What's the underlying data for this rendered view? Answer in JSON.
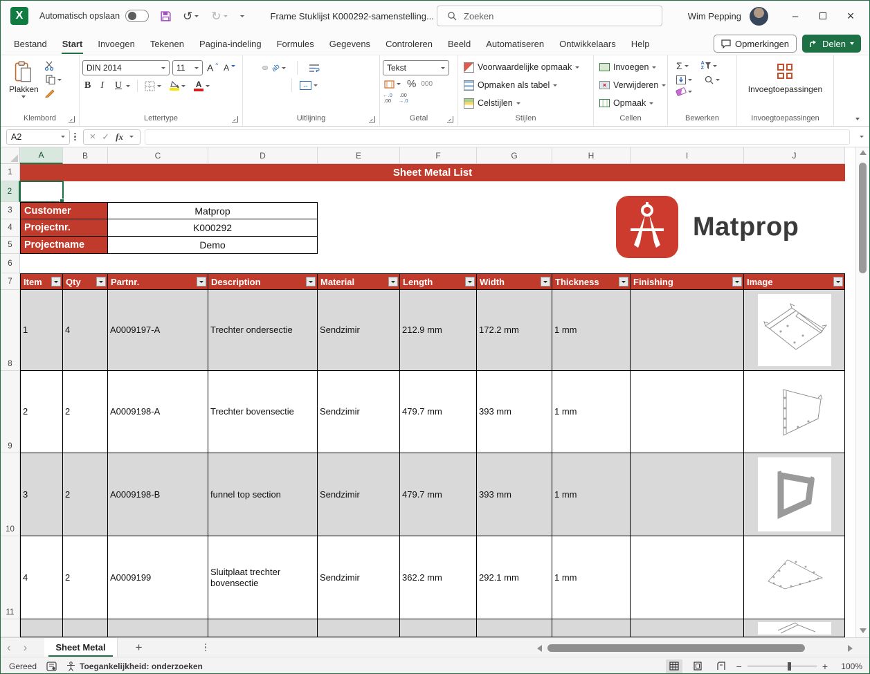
{
  "window": {
    "autosave_label": "Automatisch opslaan",
    "title": "Frame Stuklijst K000292-samenstelling...",
    "search_placeholder": "Zoeken",
    "user_name": "Wim Pepping"
  },
  "icons": {
    "excel": "X",
    "undo": "↺",
    "redo": "↻",
    "minimize": "–",
    "close": "×",
    "cancel": "×",
    "enter": "✓",
    "fx": "fx",
    "prev_sheet": "‹",
    "next_sheet": "›",
    "add_sheet": "+",
    "sum": "Σ",
    "percent": "%",
    "thousands": "000",
    "bold": "B",
    "italic": "I",
    "underline": "U",
    "font_increase": "A",
    "font_decrease": "A",
    "font_color": "A",
    "merge_arrows": "↔",
    "orientation": "ab",
    "sort_a": "A",
    "sort_z": "Z",
    "dec_left": "←.0",
    "dec_left2": ".00",
    "dec_right": ".00",
    "dec_right2": "→.0"
  },
  "ribbon": {
    "tabs": [
      "Bestand",
      "Start",
      "Invoegen",
      "Tekenen",
      "Pagina-indeling",
      "Formules",
      "Gegevens",
      "Controleren",
      "Beeld",
      "Automatiseren",
      "Ontwikkelaars",
      "Help"
    ],
    "comments_label": "Opmerkingen",
    "share_label": "Delen",
    "paste_label": "Plakken",
    "font_name": "DIN 2014",
    "font_size": "11",
    "number_format": "Tekst",
    "styles": {
      "conditional": "Voorwaardelijke opmaak",
      "format_table": "Opmaken als tabel",
      "cell_styles": "Celstijlen"
    },
    "cells": {
      "insert": "Invoegen",
      "delete": "Verwijderen",
      "format": "Opmaak"
    },
    "addins_button": "Invoegtoepassingen",
    "groups": {
      "clipboard": "Klembord",
      "font": "Lettertype",
      "alignment": "Uitlijning",
      "number": "Getal",
      "styles": "Stijlen",
      "cells": "Cellen",
      "editing": "Bewerken",
      "addins": "Invoegtoepassingen"
    }
  },
  "formula_bar": {
    "name_box": "A2",
    "formula": ""
  },
  "sheet": {
    "columns": [
      "A",
      "B",
      "C",
      "D",
      "E",
      "F",
      "G",
      "H",
      "I",
      "J"
    ],
    "row_headers": [
      "1",
      "2",
      "3",
      "4",
      "5",
      "6",
      "7",
      "8",
      "9",
      "10",
      "11"
    ],
    "banner_title": "Sheet Metal List",
    "info_labels": [
      "Customer",
      "Projectnr.",
      "Projectname"
    ],
    "info_values": [
      "Matprop",
      "K000292",
      "Demo"
    ],
    "logo_text": "Matprop",
    "table_headers": [
      "Item",
      "Qty",
      "Partnr.",
      "Description",
      "Material",
      "Length",
      "Width",
      "Thickness",
      "Finishing",
      "Image"
    ],
    "rows": [
      {
        "item": "1",
        "qty": "4",
        "partnr": "A0009197-A",
        "description": "Trechter ondersectie",
        "material": "Sendzimir",
        "length": "212.9 mm",
        "width": "172.2 mm",
        "thickness": "1 mm",
        "finishing": ""
      },
      {
        "item": "2",
        "qty": "2",
        "partnr": "A0009198-A",
        "description": "Trechter bovensectie",
        "material": "Sendzimir",
        "length": "479.7 mm",
        "width": "393 mm",
        "thickness": "1 mm",
        "finishing": ""
      },
      {
        "item": "3",
        "qty": "2",
        "partnr": "A0009198-B",
        "description": "funnel top section",
        "material": "Sendzimir",
        "length": "479.7 mm",
        "width": "393 mm",
        "thickness": "1 mm",
        "finishing": ""
      },
      {
        "item": "4",
        "qty": "2",
        "partnr": "A0009199",
        "description": "Sluitplaat trechter bovensectie",
        "material": "Sendzimir",
        "length": "362.2 mm",
        "width": "292.1 mm",
        "thickness": "1 mm",
        "finishing": ""
      }
    ]
  },
  "sheet_tabs": {
    "active": "Sheet Metal"
  },
  "status_bar": {
    "mode": "Gereed",
    "accessibility": "Toegankelijkheid: onderzoeken",
    "zoom": "100%"
  },
  "colors": {
    "accent_green": "#1e7145",
    "banner_red": "#c13b2c",
    "row_gray": "#d9d9d9"
  }
}
